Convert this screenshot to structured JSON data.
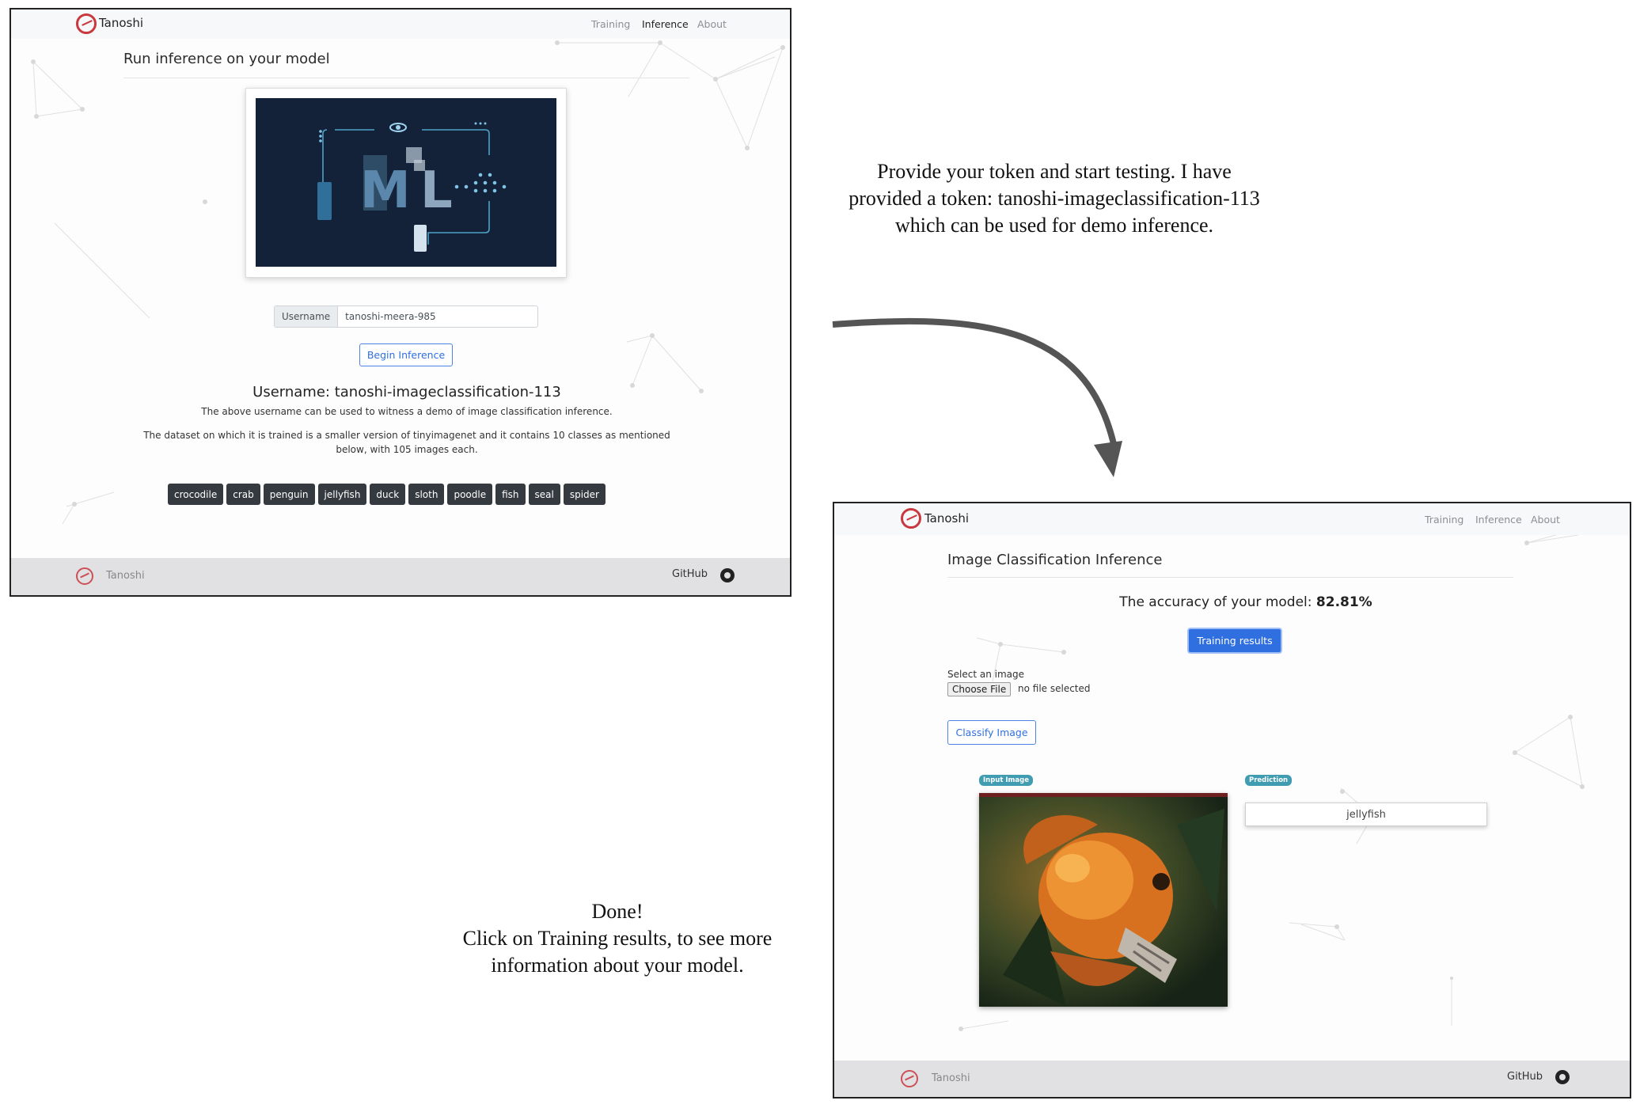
{
  "annotations": {
    "provide_lines": [
      "Provide your token and start testing. I have",
      "provided a token: tanoshi-imageclassification-113",
      "which can be used for demo inference."
    ],
    "done_lines": [
      "Done!",
      "Click on Training results, to see more",
      "information about your model."
    ]
  },
  "screen1": {
    "brand": "Tanoshi",
    "nav": [
      "Training",
      "Inference",
      "About"
    ],
    "active_nav": "Inference",
    "title": "Run inference on your model",
    "hero_letters": [
      "M",
      "L"
    ],
    "username_label": "Username",
    "username_value": "tanoshi-meera-985",
    "begin_button": "Begin Inference",
    "heading": "Username: tanoshi-imageclassification-113",
    "desc1": "The above username can be used to witness a demo of image classification inference.",
    "desc2_lines": [
      "The dataset on which it is trained is a smaller version of tinyimagenet and it contains 10 classes as mentioned",
      "below, with 105 images each."
    ],
    "classes": [
      "crocodile",
      "crab",
      "penguin",
      "jellyfish",
      "duck",
      "sloth",
      "poodle",
      "fish",
      "seal",
      "spider"
    ],
    "footer_brand": "Tanoshi",
    "footer_github": "GitHub"
  },
  "screen2": {
    "brand": "Tanoshi",
    "nav": [
      "Training",
      "Inference",
      "About"
    ],
    "title": "Image Classification Inference",
    "accuracy_label": "The accuracy of your model:",
    "accuracy_value": "82.81%",
    "training_button": "Training results",
    "select_label": "Select an image",
    "choose_file": "Choose File",
    "no_file": "no file selected",
    "classify_button": "Classify Image",
    "input_badge": "Input Image",
    "prediction_badge": "Prediction",
    "prediction": "jellyfish",
    "footer_brand": "Tanoshi",
    "footer_github": "GitHub"
  },
  "colors": {
    "accent_blue": "#2f6fe0",
    "brand_red": "#c9383f",
    "tag_dark": "#343a40",
    "badge_teal": "#3f9cb1",
    "hero_navy": "#132238"
  }
}
